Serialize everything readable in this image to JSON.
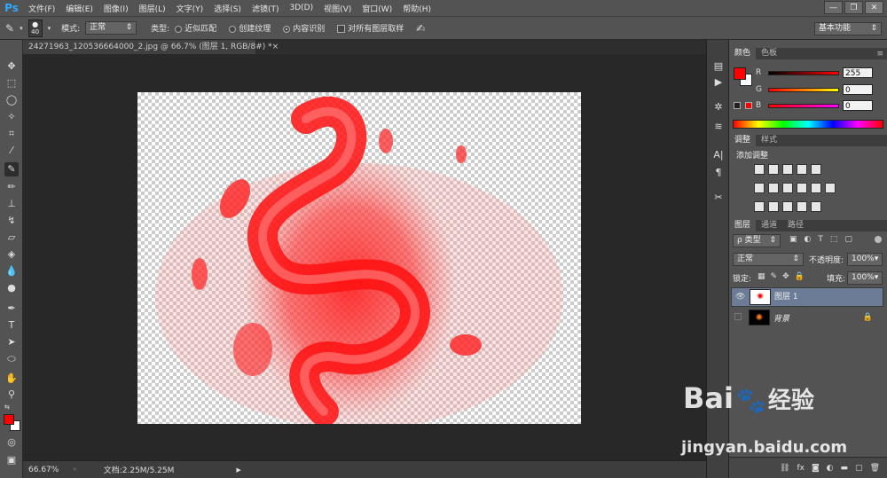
{
  "app": {
    "logo": "Ps"
  },
  "menu": [
    "文件(F)",
    "编辑(E)",
    "图像(I)",
    "图层(L)",
    "文字(Y)",
    "选择(S)",
    "滤镜(T)",
    "3D(D)",
    "视图(V)",
    "窗口(W)",
    "帮助(H)"
  ],
  "window_controls": {
    "minimize": "—",
    "restore": "❐",
    "close": "✕"
  },
  "options": {
    "brush_size": "40",
    "mode_label": "模式:",
    "mode_value": "正常",
    "type_label": "类型:",
    "radio1": "近似匹配",
    "radio2": "创建纹理",
    "radio3": "内容识别",
    "sample_all": "对所有图层取样",
    "workspace": "基本功能"
  },
  "document": {
    "tab_title": "24271963_120536664000_2.jpg @ 66.7% (图层 1, RGB/8#) *",
    "close": "×"
  },
  "status": {
    "zoom": "66.67%",
    "doc_size": "文档:2.25M/5.25M"
  },
  "color_panel": {
    "tabs": [
      "颜色",
      "色板"
    ],
    "r_label": "R",
    "r_value": "255",
    "g_label": "G",
    "g_value": "0",
    "b_label": "B",
    "b_value": "0",
    "fg_color": "#ff0000"
  },
  "adjust_panel": {
    "tabs": [
      "调整",
      "样式"
    ],
    "title": "添加调整"
  },
  "layers_panel": {
    "tabs": [
      "图层",
      "通道",
      "路径"
    ],
    "filter_label": "ρ 类型",
    "blend_mode": "正常",
    "opacity_label": "不透明度:",
    "opacity_value": "100%",
    "lock_label": "锁定:",
    "fill_label": "填充:",
    "fill_value": "100%",
    "layers": [
      {
        "name": "图层 1",
        "visible": true,
        "selected": true
      },
      {
        "name": "背景",
        "visible": false,
        "selected": false,
        "locked": true
      }
    ]
  },
  "watermark": {
    "brand": "Bai",
    "brand_cn": "经验",
    "url": "jingyan.baidu.com"
  },
  "icons": {
    "paw": "paw-icon"
  }
}
